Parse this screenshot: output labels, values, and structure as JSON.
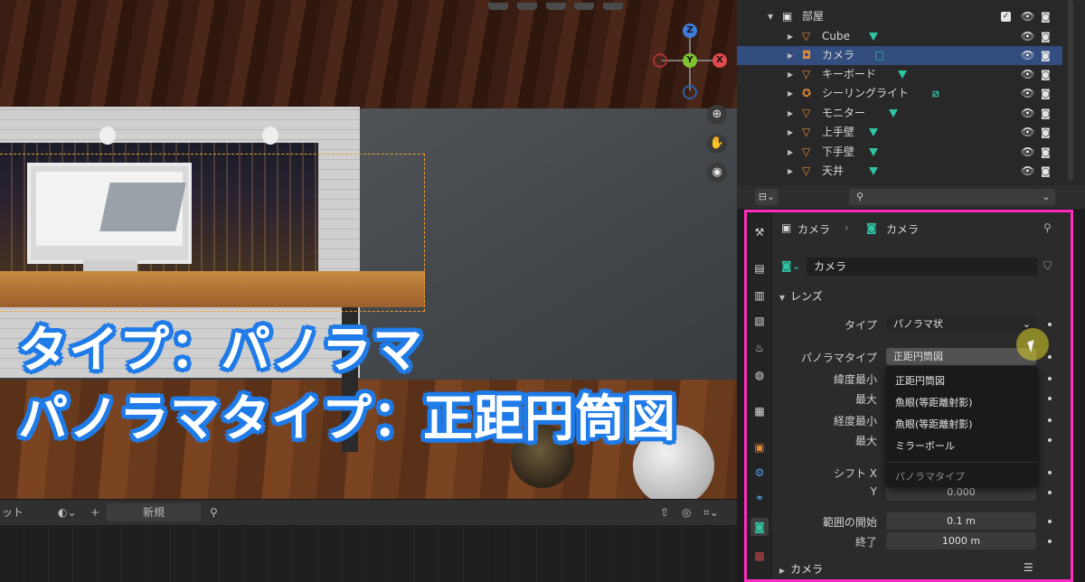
{
  "caption": {
    "line1": "タイプ：パノラマ",
    "line2": "パノラマタイプ：正距円筒図"
  },
  "gizmo": {
    "z": "Z",
    "y": "Y",
    "x": "X"
  },
  "timeline": {
    "left_label": "ット",
    "plus": "+",
    "new_label": "新規"
  },
  "outliner": {
    "collection": "部屋",
    "items": [
      {
        "label": "Cube"
      },
      {
        "label": "カメラ"
      },
      {
        "label": "キーボード"
      },
      {
        "label": "シーリングライト"
      },
      {
        "label": "モニター"
      },
      {
        "label": "上手壁"
      },
      {
        "label": "下手壁"
      },
      {
        "label": "天井"
      }
    ]
  },
  "properties": {
    "breadcrumb_object": "カメラ",
    "breadcrumb_sep": "›",
    "breadcrumb_data": "カメラ",
    "name_value": "カメラ",
    "lens_panel": "レンズ",
    "type_label": "タイプ",
    "type_value": "パノラマ状",
    "panorama_type_label": "パノラマタイプ",
    "panorama_type_value": "正距円筒図",
    "lat_min_label": "緯度最小",
    "lat_max_label": "最大",
    "lon_min_label": "経度最小",
    "lon_max_label": "最大",
    "shift_x_label": "シフト X",
    "shift_y_label": "Y",
    "shift_y_value": "0.000",
    "clip_start_label": "範囲の開始",
    "clip_start_value": "0.1 m",
    "clip_end_label": "終了",
    "clip_end_value": "1000 m",
    "camera_panel": "カメラ"
  },
  "dropdown": {
    "items": [
      "正距円筒図",
      "魚眼(等距離射影)",
      "魚眼(等距離射影)",
      "ミラーボール"
    ],
    "title": "パノラマタイプ"
  },
  "colors": {
    "highlight_border": "#ff2bbd",
    "caption_outline": "#1f7be8",
    "selected_row": "#334d80",
    "mesh_icon": "#2ec4a4"
  }
}
